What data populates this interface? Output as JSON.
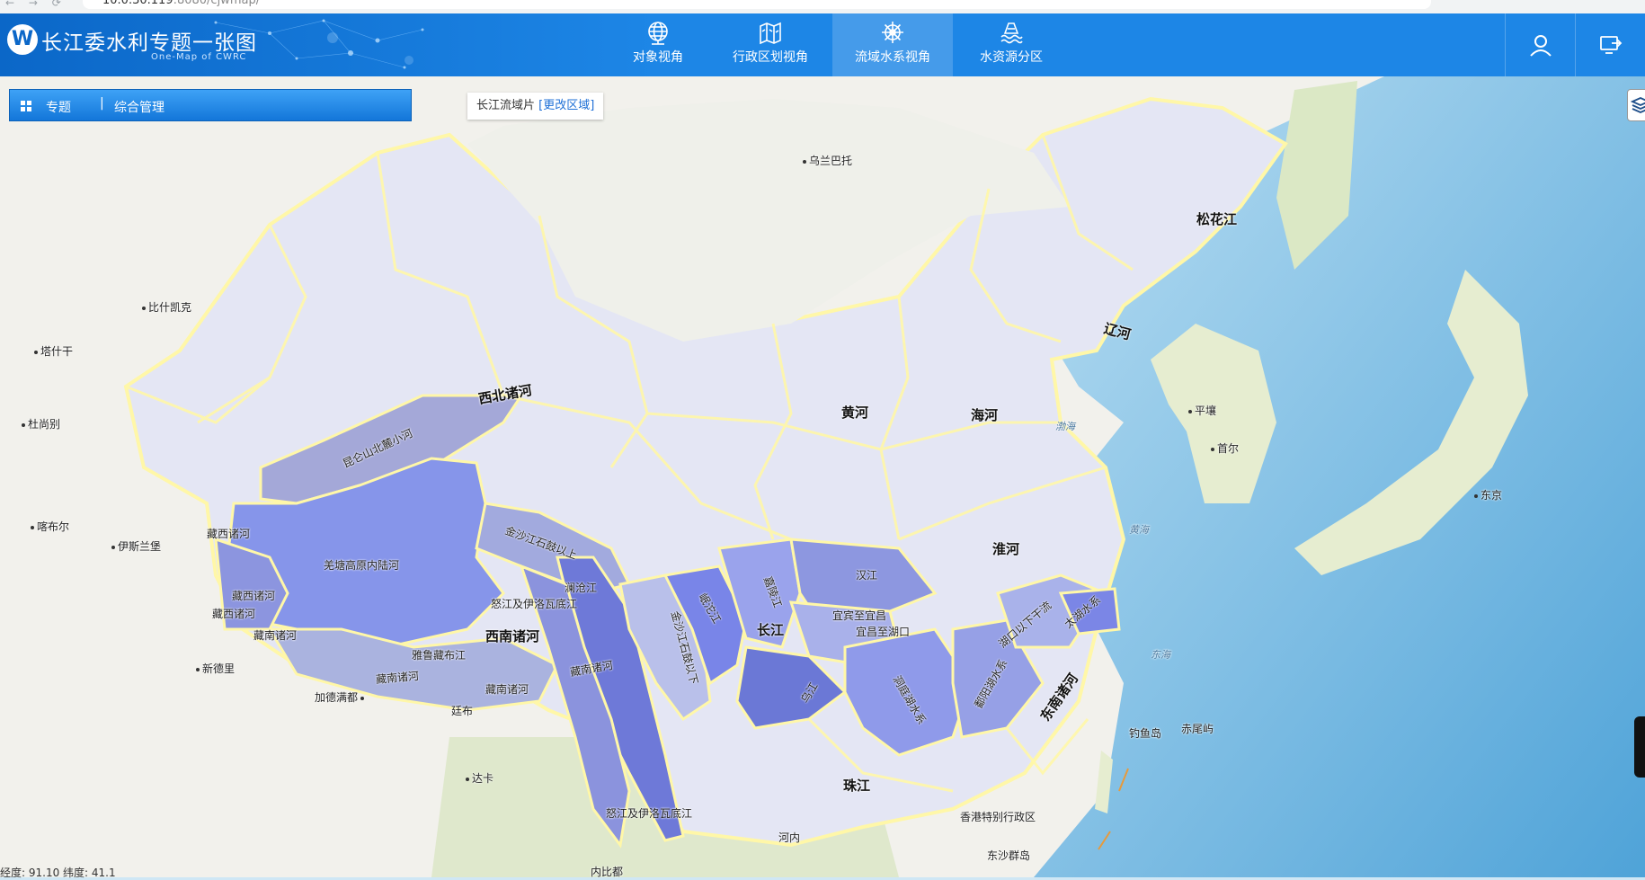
{
  "browser": {
    "url_visible": "10.0.30.119",
    "url_dim": ":8080/cjwmap/"
  },
  "header": {
    "title": "长江委水利专题一张图",
    "subtitle": "One-Map of CWRC",
    "tabs": [
      {
        "label": "对象视角",
        "icon": "globe-icon",
        "active": false
      },
      {
        "label": "行政区划视角",
        "icon": "folded-map-icon",
        "active": false
      },
      {
        "label": "流域水系视角",
        "icon": "ship-wheel-icon",
        "active": true
      },
      {
        "label": "水资源分区",
        "icon": "boat-water-icon",
        "active": false
      }
    ],
    "user_icon": "user-icon",
    "exit_icon": "exit-screen-icon"
  },
  "toolbar": {
    "theme_label": "专题",
    "separator": "|",
    "manage_label": "综合管理"
  },
  "region": {
    "label": "长江流域片",
    "change": "[更改区域]"
  },
  "status": {
    "coords": "经度: 91.10  纬度: 41.1"
  },
  "map_labels": {
    "cities": {
      "ulaanbaatar": "乌兰巴托",
      "bishkek": "比什凯克",
      "tashkent": "塔什干",
      "dushanbe": "杜尚别",
      "kabul": "喀布尔",
      "islamabad": "伊斯兰堡",
      "new_delhi": "新德里",
      "kathmandu": "加德满都",
      "thimphu": "廷布",
      "dhaka": "达卡",
      "naypyidaw": "内比都",
      "hanoi": "河内",
      "pyongyang": "平壤",
      "seoul": "首尔",
      "tokyo": "东京",
      "hk": "香港特别行政区",
      "diaoyu": "钓鱼岛",
      "chiwei": "赤尾屿",
      "dongsha": "东沙群岛"
    },
    "seas": {
      "bohai": "渤海",
      "yellow_sea": "黄海",
      "east_sea": "东海"
    },
    "basins": {
      "songhua": "松花江",
      "liao": "辽河",
      "hai": "海河",
      "yellow": "黄河",
      "huai": "淮河",
      "yangtze": "长江",
      "pearl": "珠江",
      "southeast": "东南诸河",
      "northwest": "西北诸河",
      "southwest": "西南诸河",
      "kunlun": "昆仑山北麓小河",
      "qiangtang": "羌塘高原内陆河",
      "tibet_west_1": "藏西诸河",
      "tibet_west_2": "藏西诸河",
      "tibet_west_3": "藏西诸河",
      "tibet_south_1": "藏南诸河",
      "tibet_south_2": "藏南诸河",
      "tibet_south_3": "藏南诸河",
      "tibet_south_4": "藏南诸河",
      "yarlung": "雅鲁藏布江",
      "jinsha_up": "金沙江石鼓以上",
      "lancang": "澜沧江",
      "nu_ir_1": "怒江及伊洛瓦底江",
      "nu_ir_2": "怒江及伊洛瓦底江",
      "jinsha_down": "金沙江石鼓以下",
      "minjiang": "岷沱江",
      "jialing": "嘉陵江",
      "hanjiang": "汉江",
      "yibin_yichang": "宜宾至宜昌",
      "yichang_hukou": "宜昌至湖口",
      "wujiang": "乌江",
      "dongting": "洞庭湖水系",
      "poyang": "鄱阳湖水系",
      "hukou_below": "湖口以下干流",
      "taihu": "太湖水系"
    }
  }
}
